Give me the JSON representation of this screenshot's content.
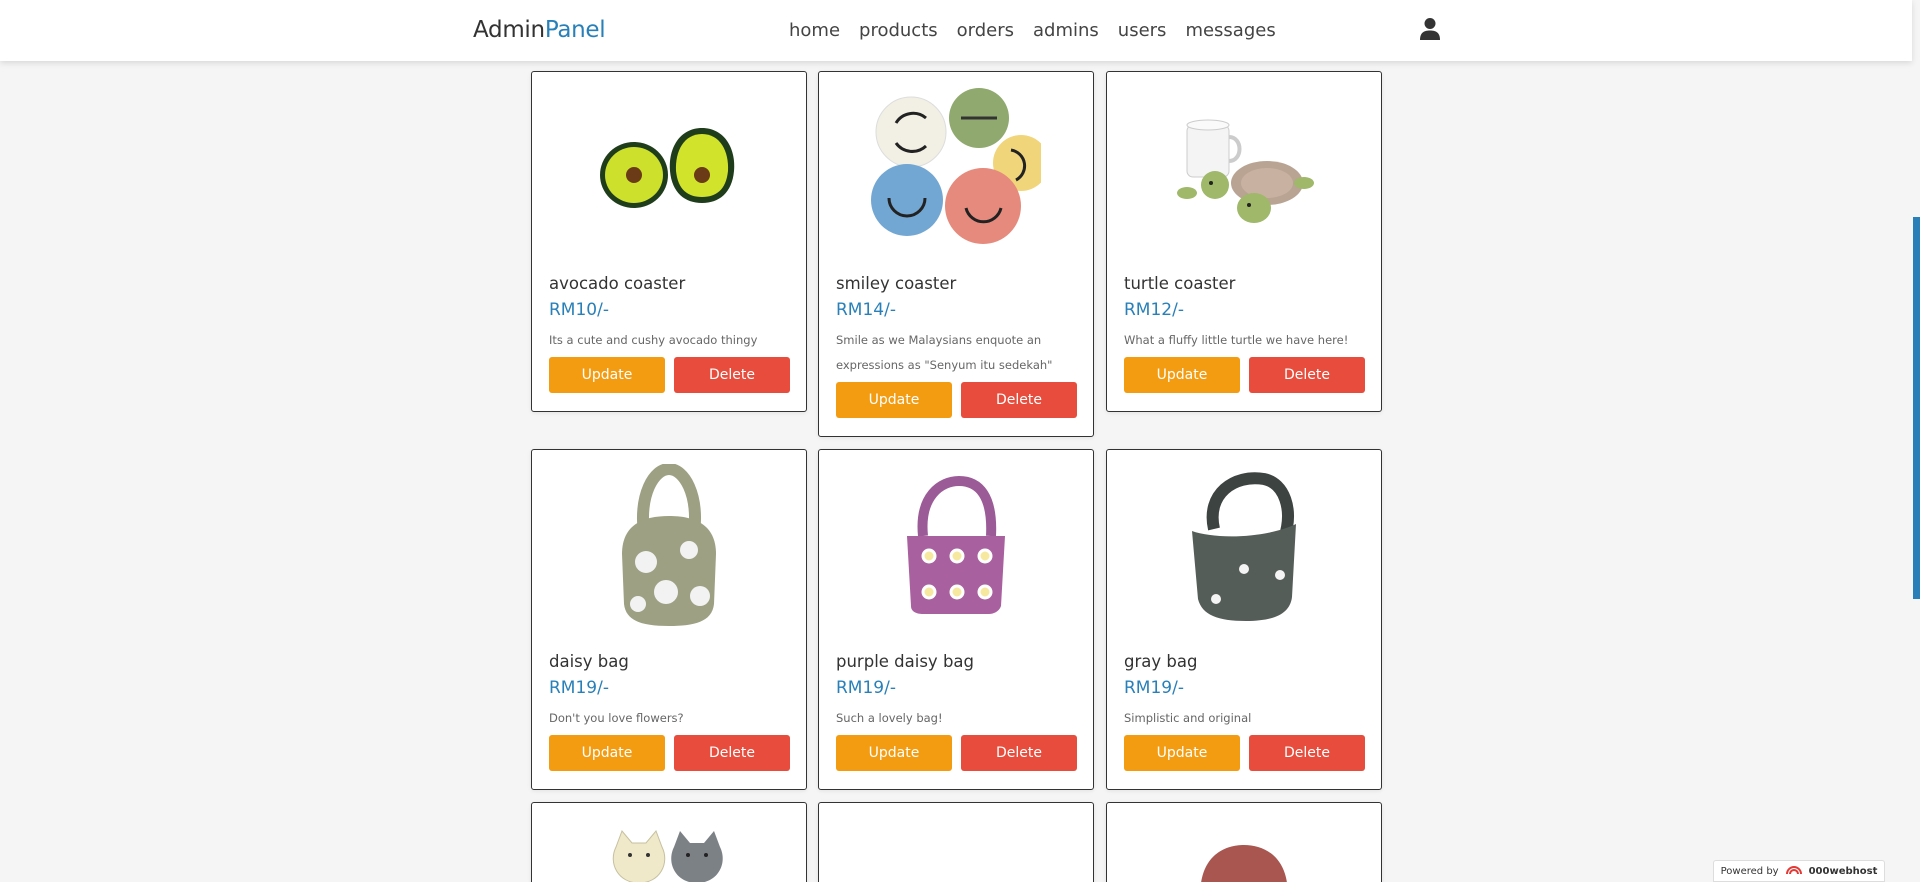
{
  "header": {
    "logo_main": "Admin",
    "logo_accent": "Panel",
    "nav": [
      "home",
      "products",
      "orders",
      "admins",
      "users",
      "messages"
    ]
  },
  "products": [
    {
      "name": "avocado coaster",
      "price": "RM10/-",
      "desc": "Its a cute and cushy avocado thingy",
      "update": "Update",
      "delete": "Delete"
    },
    {
      "name": "smiley coaster",
      "price": "RM14/-",
      "desc": "Smile as we Malaysians enquote an expressions as \"Senyum itu sedekah\"",
      "update": "Update",
      "delete": "Delete"
    },
    {
      "name": "turtle coaster",
      "price": "RM12/-",
      "desc": "What a fluffy little turtle we have here!",
      "update": "Update",
      "delete": "Delete"
    },
    {
      "name": "daisy bag",
      "price": "RM19/-",
      "desc": "Don't you love flowers?",
      "update": "Update",
      "delete": "Delete"
    },
    {
      "name": "purple daisy bag",
      "price": "RM19/-",
      "desc": "Such a lovely bag!",
      "update": "Update",
      "delete": "Delete"
    },
    {
      "name": "gray bag",
      "price": "RM19/-",
      "desc": "Simplistic and original",
      "update": "Update",
      "delete": "Delete"
    }
  ],
  "footer": {
    "powered_by": "Powered by",
    "brand": "000webhost"
  },
  "colors": {
    "accent": "#2980b9",
    "update": "#f39c12",
    "delete": "#e74c3c"
  }
}
